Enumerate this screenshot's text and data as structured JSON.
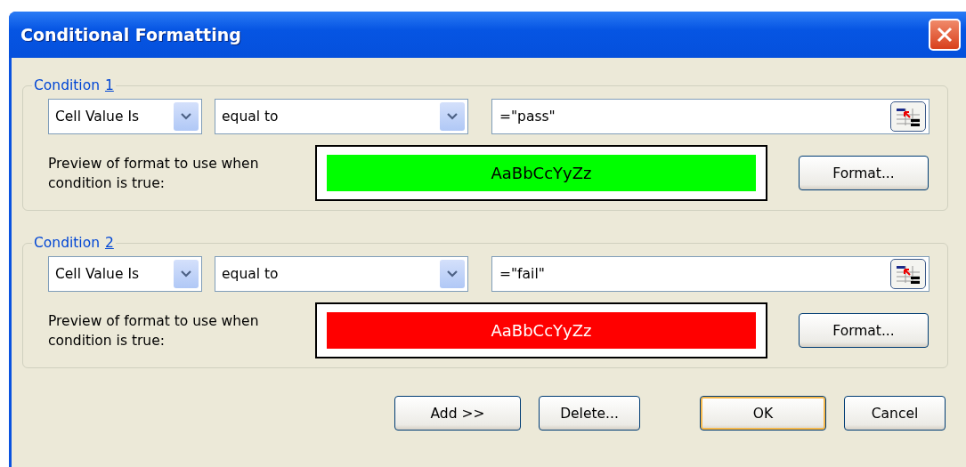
{
  "window": {
    "title": "Conditional Formatting"
  },
  "conditions": [
    {
      "label": "Condition",
      "number": "1",
      "type": "Cell Value Is",
      "operator": "equal to",
      "value": "=\"pass\"",
      "preview_label": "Preview of format to use when condition is true:",
      "preview_text": "AaBbCcYyZz",
      "color": "#00ff00",
      "format_button": "Format..."
    },
    {
      "label": "Condition",
      "number": "2",
      "type": "Cell Value Is",
      "operator": "equal to",
      "value": "=\"fail\"",
      "preview_label": "Preview of format to use when condition is true:",
      "preview_text": "AaBbCcYyZz",
      "color": "#ff0000",
      "format_button": "Format..."
    }
  ],
  "buttons": [
    {
      "label": "Add >>",
      "default": false
    },
    {
      "label": "Delete...",
      "default": false
    },
    {
      "label": "OK",
      "default": true
    },
    {
      "label": "Cancel",
      "default": false
    }
  ]
}
